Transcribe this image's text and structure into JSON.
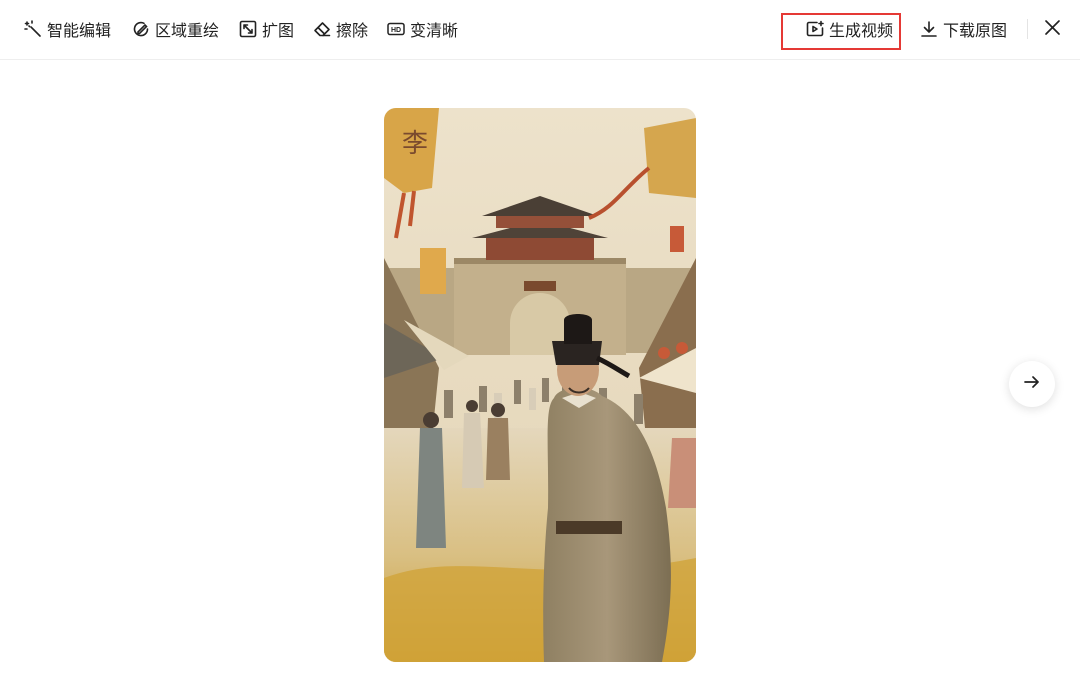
{
  "toolbar": {
    "tools": [
      {
        "label": "智能编辑",
        "icon": "magic-wand-icon"
      },
      {
        "label": "区域重绘",
        "icon": "redraw-icon"
      },
      {
        "label": "扩图",
        "icon": "expand-icon"
      },
      {
        "label": "擦除",
        "icon": "eraser-icon"
      },
      {
        "label": "变清晰",
        "icon": "hd-icon"
      }
    ],
    "generate_video": {
      "label": "生成视频",
      "icon": "video-add-icon"
    },
    "download": {
      "label": "下载原图",
      "icon": "download-icon"
    },
    "close_icon": "close-icon",
    "highlight_color": "#e53935"
  },
  "viewer": {
    "image_alt": "",
    "banner_text": "李",
    "next_icon": "arrow-right-icon"
  }
}
